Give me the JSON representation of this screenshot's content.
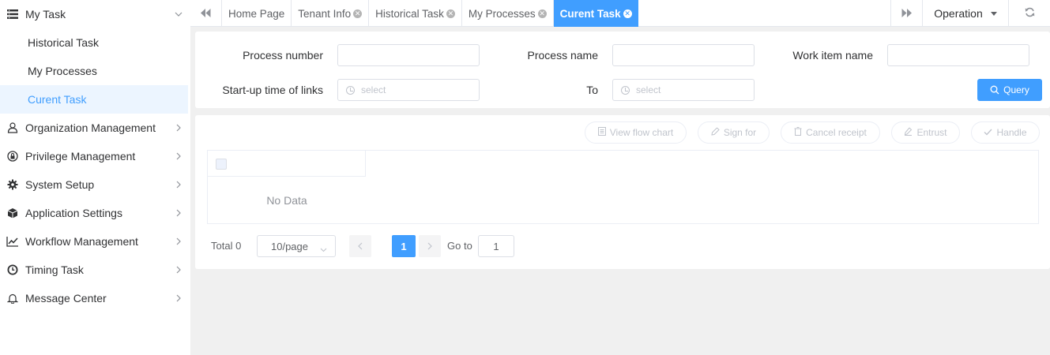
{
  "sidebar": {
    "my_task": {
      "label": "My Task",
      "icon": "list-icon"
    },
    "submenu": [
      {
        "label": "Historical Task"
      },
      {
        "label": "My Processes"
      },
      {
        "label": "Curent Task",
        "active": true
      }
    ],
    "items": [
      {
        "label": "Organization Management",
        "icon": "user-icon"
      },
      {
        "label": "Privilege Management",
        "icon": "lock-icon"
      },
      {
        "label": "System Setup",
        "icon": "gear-icon"
      },
      {
        "label": "Application Settings",
        "icon": "cube-icon"
      },
      {
        "label": "Workflow Management",
        "icon": "line-chart-icon"
      },
      {
        "label": "Timing Task",
        "icon": "clock-icon"
      },
      {
        "label": "Message Center",
        "icon": "bell-icon"
      }
    ]
  },
  "tabs": [
    {
      "label": "Home Page",
      "closable": false
    },
    {
      "label": "Tenant Info",
      "closable": true
    },
    {
      "label": "Historical Task",
      "closable": true
    },
    {
      "label": "My Processes",
      "closable": true
    },
    {
      "label": "Curent Task",
      "closable": true,
      "active": true
    }
  ],
  "header": {
    "operation_label": "Operation"
  },
  "search": {
    "process_number_label": "Process number",
    "process_name_label": "Process name",
    "work_item_name_label": "Work item name",
    "startup_time_label": "Start-up time of links",
    "to_label": "To",
    "start_placeholder": "select",
    "end_placeholder": "select",
    "query_label": "Query"
  },
  "actions": {
    "view_flow_chart": "View flow chart",
    "sign_for": "Sign for",
    "cancel_receipt": "Cancel receipt",
    "entrust": "Entrust",
    "handle": "Handle"
  },
  "table": {
    "empty_text": "No Data"
  },
  "pagination": {
    "total_label": "Total 0",
    "page_size": "10/page",
    "current_page": "1",
    "goto_label": "Go to",
    "goto_value": "1"
  },
  "colors": {
    "accent": "#409eff",
    "active_bg": "#ecf5ff",
    "page_bg": "#f0f0f0"
  }
}
